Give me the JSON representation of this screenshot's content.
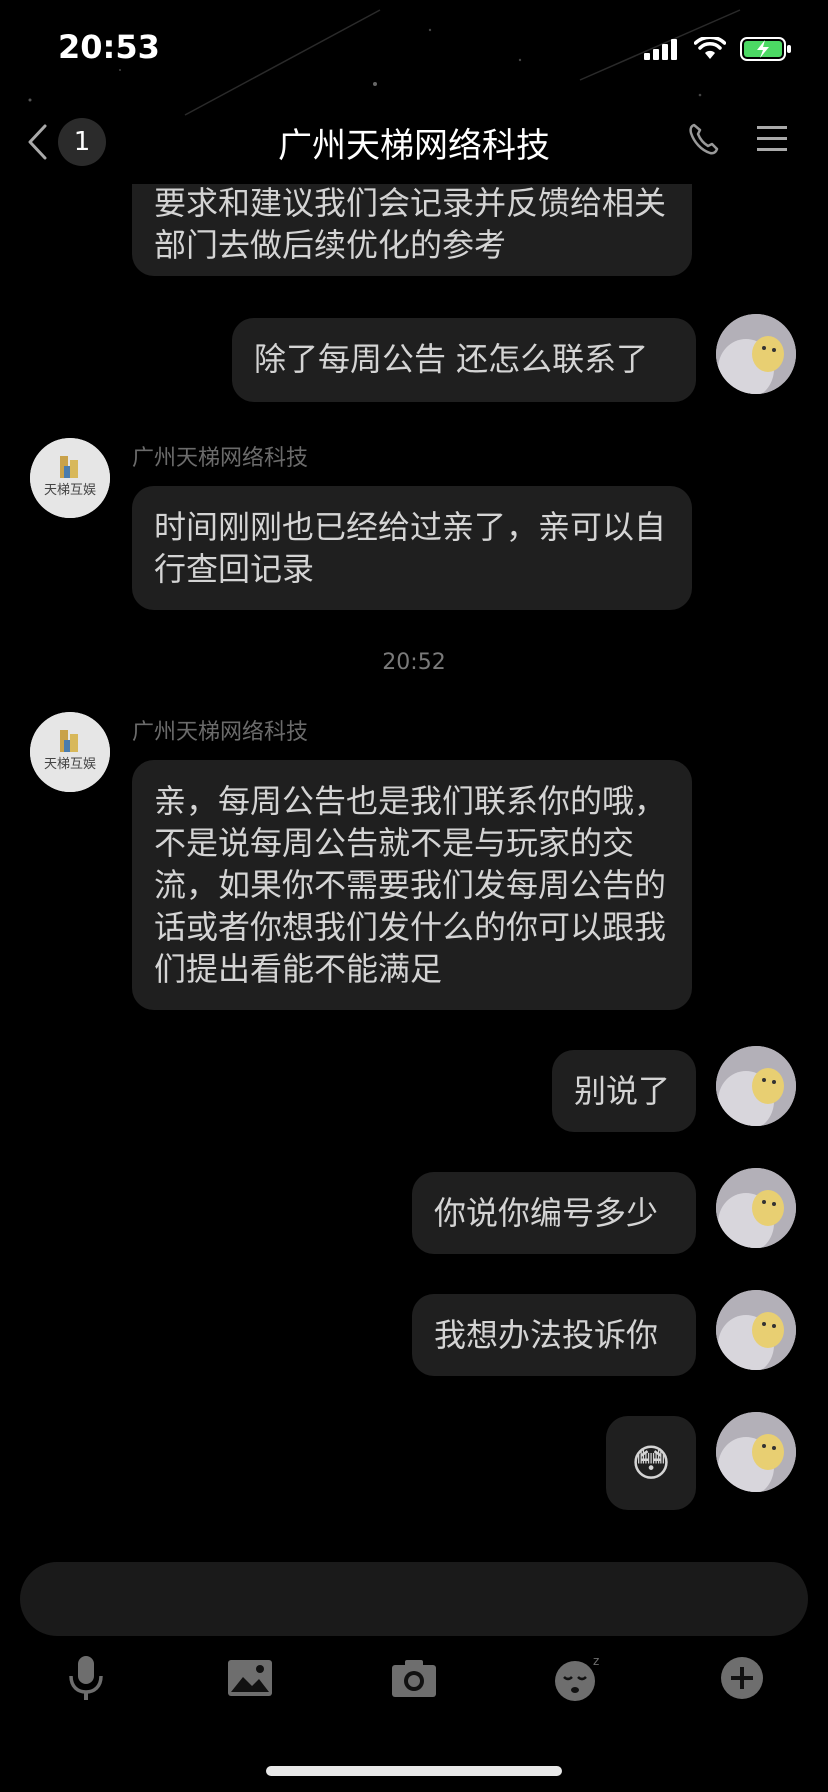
{
  "status_bar": {
    "time": "20:53"
  },
  "header": {
    "unread_count": "1",
    "title": "广州天梯网络科技"
  },
  "messages": {
    "m0": {
      "text": "要求和建议我们会记录并反馈给相关部门去做后续优化的参考"
    },
    "m1": {
      "text": "除了每周公告 还怎么联系了"
    },
    "m2": {
      "sender": "广州天梯网络科技",
      "text": "时间刚刚也已经给过亲了，亲可以自行查回记录"
    },
    "time_divider": "20:52",
    "m3": {
      "sender": "广州天梯网络科技",
      "text": "亲，每周公告也是我们联系你的哦，不是说每周公告就不是与玩家的交流，如果你不需要我们发每周公告的话或者你想我们发什么的你可以跟我们提出看能不能满足"
    },
    "m4": {
      "text": "别说了"
    },
    "m5": {
      "text": "你说你编号多少"
    },
    "m6": {
      "text": "我想办法投诉你"
    },
    "m7": {
      "emoji": "😳"
    }
  },
  "company_avatar_text": "天梯互娱",
  "icons": {
    "back": "chevron-left-icon",
    "phone": "phone-icon",
    "menu": "menu-icon",
    "mic": "mic-icon",
    "image": "image-icon",
    "camera": "camera-icon",
    "emoji": "sleepy-emoji-icon",
    "plus": "plus-icon"
  }
}
